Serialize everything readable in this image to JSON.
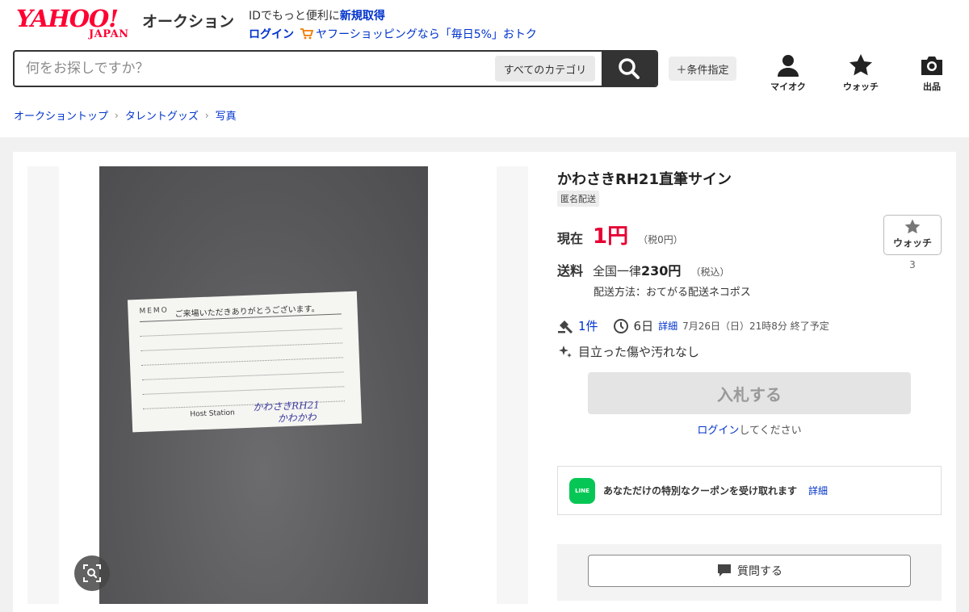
{
  "header": {
    "logo_text": "YAHOO!",
    "logo_sub": "JAPAN",
    "service_name": "オークション",
    "promo_text": "IDでもっと便利に",
    "promo_link": "新規取得",
    "login_link": "ログイン",
    "shopping_promo": "ヤフーショッピングなら「毎日5%」おトク"
  },
  "search": {
    "placeholder": "何をお探しですか？",
    "category": "すべてのカテゴリ",
    "condition_button": "＋条件指定"
  },
  "nav_icons": [
    {
      "label": "マイオク",
      "icon": "person-icon"
    },
    {
      "label": "ウォッチ",
      "icon": "star-icon"
    },
    {
      "label": "出品",
      "icon": "camera-icon"
    }
  ],
  "breadcrumb": [
    "オークショントップ",
    "タレントグッズ",
    "写真"
  ],
  "photo_card": {
    "memo": "MEMO",
    "thanks": "ご来場いただきありがとうございます。",
    "host": "Host Station",
    "sign_line1": "かわさきRH21",
    "sign_line2": "かわかわ"
  },
  "item": {
    "title": "かわさきRH21直筆サイン",
    "badge": "匿名配送",
    "price_label": "現在",
    "price": "1円",
    "price_tax": "（税0円）",
    "watch_label": "ウォッチ",
    "watch_count": "3",
    "shipping_label": "送料",
    "shipping_area": "全国一律",
    "shipping_price": "230円",
    "shipping_tax": "（税込）",
    "shipping_method": "配送方法：おてがる配送ネコポス",
    "bids": "1件",
    "time_left": "6日",
    "detail_link": "詳細",
    "end_time": "7月26日（日）21時8分 終了予定",
    "condition": "目立った傷や汚れなし",
    "bid_button": "入札する",
    "login_link": "ログイン",
    "login_suffix": "してください"
  },
  "coupon": {
    "icon_text": "LINE",
    "text": "あなただけの特別なクーポンを受け取れます",
    "link": "詳細"
  },
  "question_button": "質問する",
  "colors": {
    "brand_red": "#ff0033",
    "price_red": "#e60033",
    "link_blue": "#0033cc",
    "line_green": "#06c755"
  }
}
